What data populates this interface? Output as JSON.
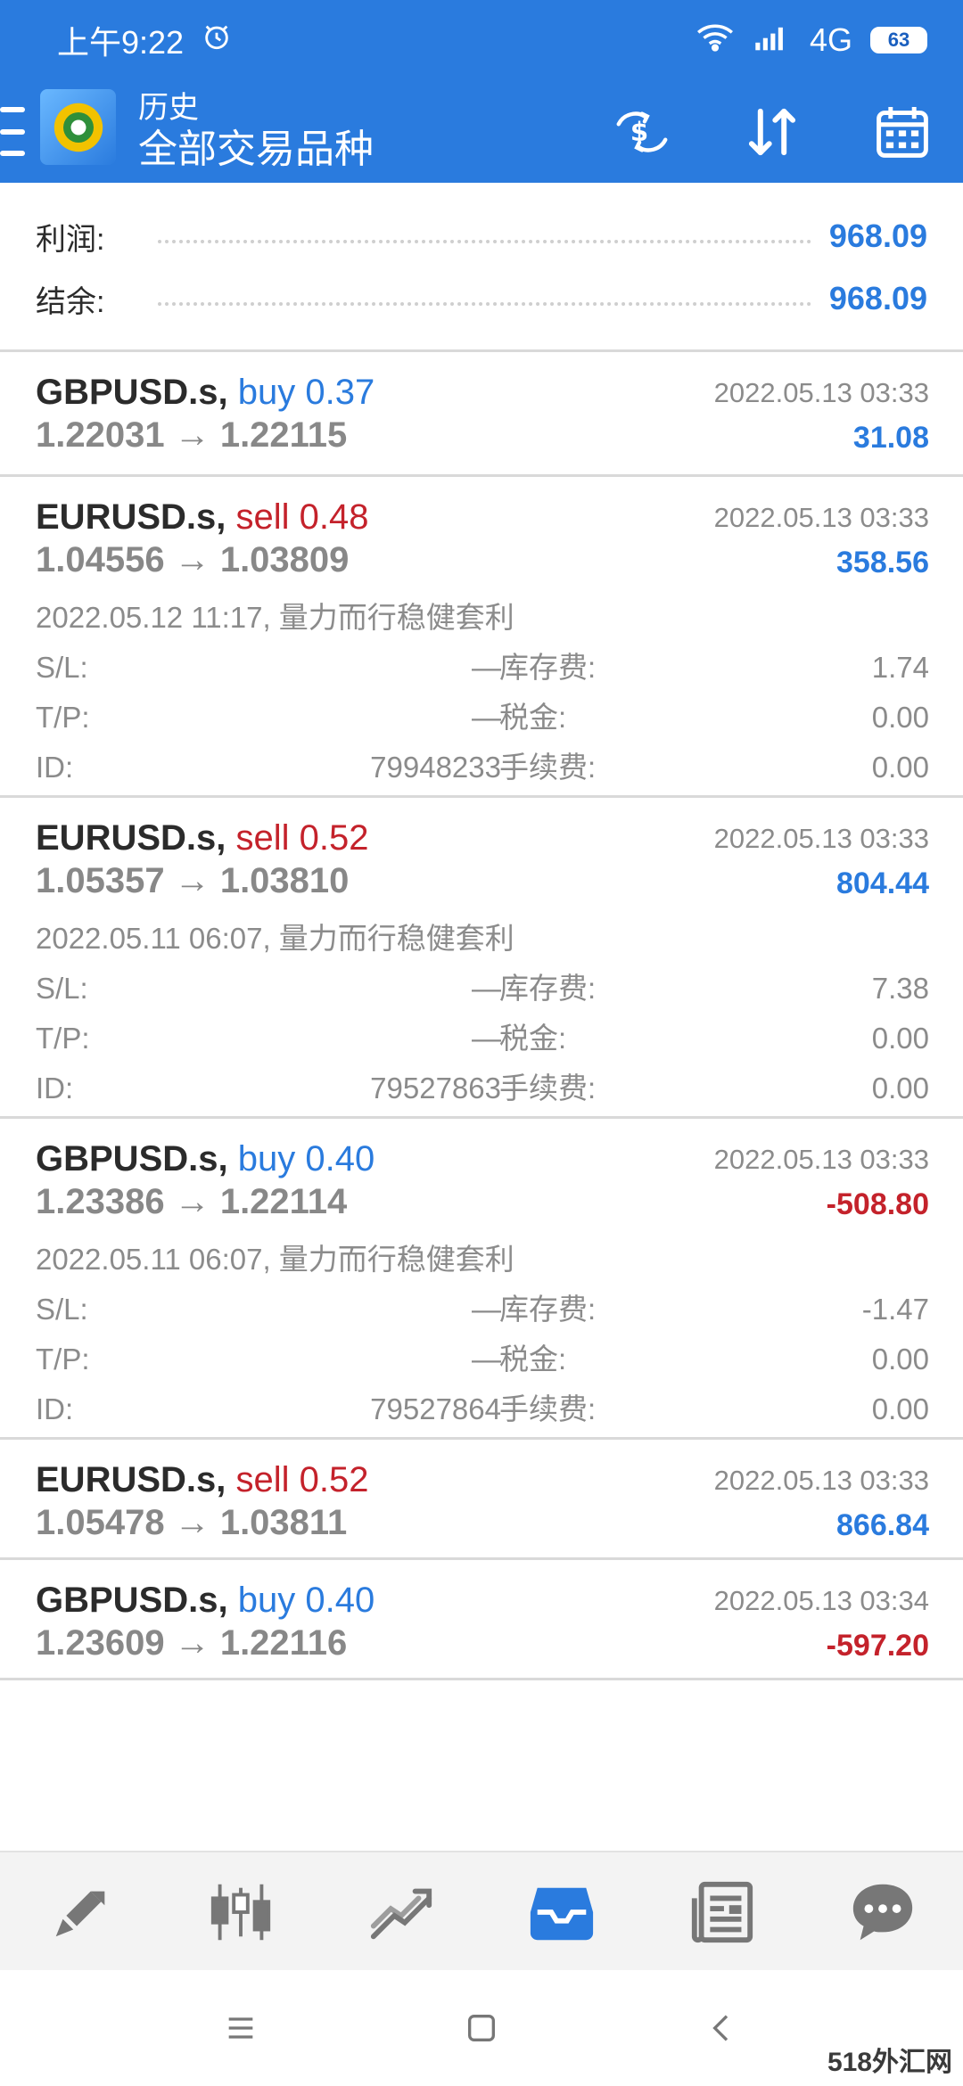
{
  "status_bar": {
    "time": "上午9:22",
    "network": "4G",
    "battery": "63"
  },
  "app_bar": {
    "subtitle": "历史",
    "title": "全部交易品种",
    "actions": [
      "currency-exchange-icon",
      "sort-icon",
      "calendar-icon"
    ]
  },
  "summary": {
    "profit_label": "利润:",
    "profit_value": "968.09",
    "balance_label": "结余:",
    "balance_value": "968.09"
  },
  "trades": [
    {
      "symbol": "GBPUSD.s,",
      "side": "buy",
      "volume": "0.37",
      "prices": "1.22031 → 1.22115",
      "close_time": "2022.05.13 03:33",
      "profit": "31.08",
      "profit_sign": "pos"
    },
    {
      "symbol": "EURUSD.s,",
      "side": "sell",
      "volume": "0.48",
      "prices": "1.04556 → 1.03809",
      "close_time": "2022.05.13 03:33",
      "profit": "358.56",
      "profit_sign": "pos",
      "open_line": "2022.05.12 11:17, 量力而行稳健套利",
      "sl_label": "S/L:",
      "sl": "—",
      "tp_label": "T/P:",
      "tp": "—",
      "id_label": "ID:",
      "id": "79948233",
      "swap_label": "库存费:",
      "swap": "1.74",
      "tax_label": "税金:",
      "tax": "0.00",
      "fee_label": "手续费:",
      "fee": "0.00"
    },
    {
      "symbol": "EURUSD.s,",
      "side": "sell",
      "volume": "0.52",
      "prices": "1.05357 → 1.03810",
      "close_time": "2022.05.13 03:33",
      "profit": "804.44",
      "profit_sign": "pos",
      "open_line": "2022.05.11 06:07, 量力而行稳健套利",
      "sl_label": "S/L:",
      "sl": "—",
      "tp_label": "T/P:",
      "tp": "—",
      "id_label": "ID:",
      "id": "79527863",
      "swap_label": "库存费:",
      "swap": "7.38",
      "tax_label": "税金:",
      "tax": "0.00",
      "fee_label": "手续费:",
      "fee": "0.00"
    },
    {
      "symbol": "GBPUSD.s,",
      "side": "buy",
      "volume": "0.40",
      "prices": "1.23386 → 1.22114",
      "close_time": "2022.05.13 03:33",
      "profit": "-508.80",
      "profit_sign": "neg",
      "open_line": "2022.05.11 06:07, 量力而行稳健套利",
      "sl_label": "S/L:",
      "sl": "—",
      "tp_label": "T/P:",
      "tp": "—",
      "id_label": "ID:",
      "id": "79527864",
      "swap_label": "库存费:",
      "swap": "-1.47",
      "tax_label": "税金:",
      "tax": "0.00",
      "fee_label": "手续费:",
      "fee": "0.00"
    },
    {
      "symbol": "EURUSD.s,",
      "side": "sell",
      "volume": "0.52",
      "prices": "1.05478 → 1.03811",
      "close_time": "2022.05.13 03:33",
      "profit": "866.84",
      "profit_sign": "pos"
    },
    {
      "symbol": "GBPUSD.s,",
      "side": "buy",
      "volume": "0.40",
      "prices": "1.23609 → 1.22116",
      "close_time": "2022.05.13 03:34",
      "profit": "-597.20",
      "profit_sign": "neg"
    }
  ],
  "bottom_nav": {
    "items": [
      "quotes-icon",
      "chart-candles-icon",
      "trade-icon",
      "history-icon",
      "news-icon",
      "chat-icon"
    ],
    "active": 3,
    "active_color": "#2a7bde"
  },
  "watermark": "518外汇网",
  "colors": {
    "primary": "#2a7bde",
    "negative": "#c4222b",
    "muted": "#8b8b8b"
  }
}
